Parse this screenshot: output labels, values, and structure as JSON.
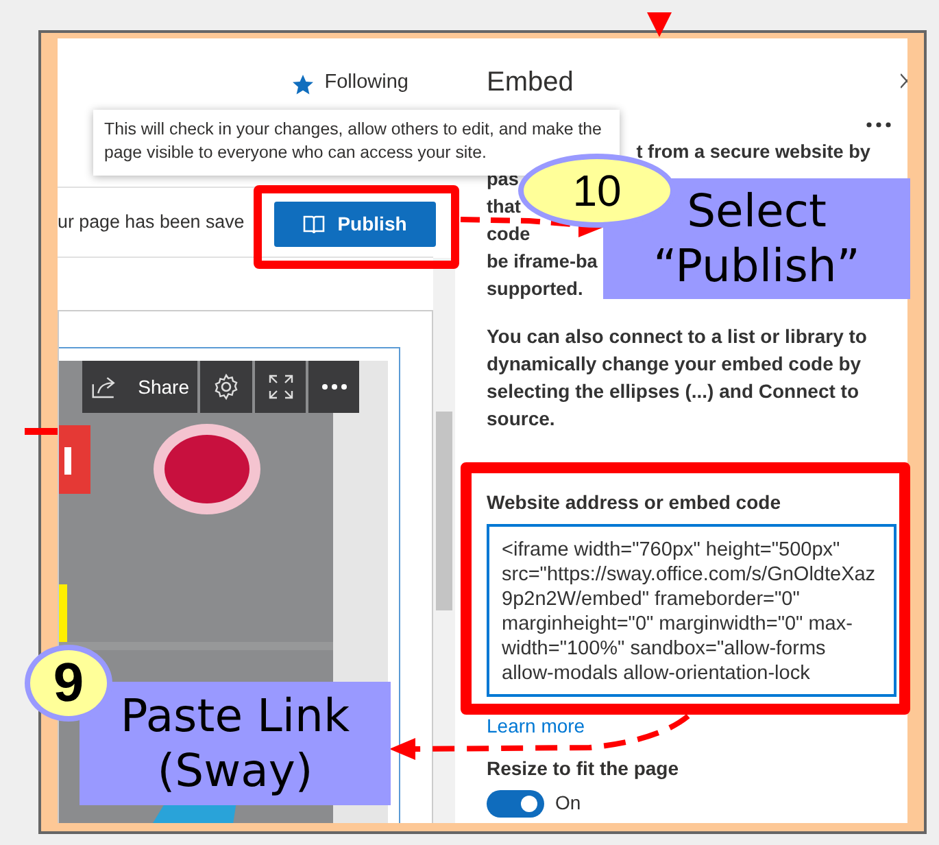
{
  "header": {
    "follow": {
      "label": "Following",
      "selected": true
    }
  },
  "tooltip": "This will check in your changes, allow others to edit, and make the page visible to everyone who can access your site.",
  "status_text": "ur page has been save",
  "publish_button": "Publish",
  "embed_preview": {
    "kind": "picture",
    "toolbar": {
      "share": "Share"
    }
  },
  "embed_panel": {
    "title": "Embed",
    "intro_lines": [
      [
        "t from a secure website by"
      ],
      [
        "pas"
      ],
      [
        "that"
      ],
      [
        "code"
      ],
      [
        "be iframe-ba"
      ],
      [
        "supported."
      ]
    ],
    "paragraph": "You can also connect to a list or library to dynamically change your embed code by selecting the ellipses (...) and Connect to source.",
    "field": {
      "label": "Website address or embed code",
      "value": "<iframe width=\"760px\" height=\"500px\" src=\"https://sway.office.com/s/GnOldteXaz9p2n2W/embed\" frameborder=\"0\" marginheight=\"0\" marginwidth=\"0\" max-width=\"100%\" sandbox=\"allow-forms allow-modals allow-orientation-lock"
    },
    "learn_more": "Learn more",
    "resize": {
      "label": "Resize to fit the page",
      "on": true,
      "state_text": "On"
    }
  },
  "annotations": [
    {
      "kind": "step",
      "number": "10",
      "text": "Select “Publish”"
    },
    {
      "kind": "step",
      "number": "9",
      "text": "Paste Link (Sway)"
    }
  ]
}
